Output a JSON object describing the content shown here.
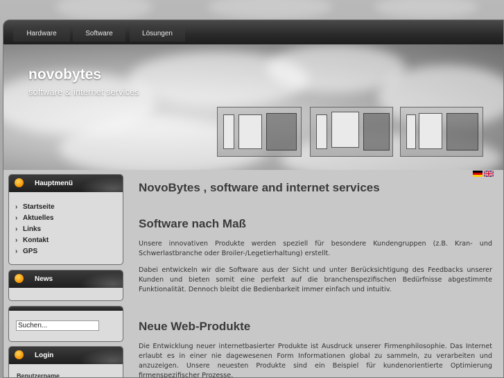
{
  "nav": {
    "tabs": [
      {
        "label": "Hardware"
      },
      {
        "label": "Software"
      },
      {
        "label": "Lösungen"
      }
    ]
  },
  "banner": {
    "title": "novobytes",
    "subtitle": "software & internet services"
  },
  "languages": {
    "flags": [
      "german-flag-icon",
      "english-flag-icon"
    ]
  },
  "sidebar": {
    "main_menu": {
      "title": "Hauptmenü",
      "items": [
        {
          "label": "Startseite"
        },
        {
          "label": "Aktuelles"
        },
        {
          "label": "Links"
        },
        {
          "label": "Kontakt"
        },
        {
          "label": "GPS"
        }
      ]
    },
    "news": {
      "title": "News"
    },
    "search": {
      "value": "Suchen..."
    },
    "login": {
      "title": "Login",
      "username_label": "Benutzername"
    }
  },
  "content": {
    "page_title": "NovoBytes , software and internet services",
    "sections": [
      {
        "heading": "Software nach Maß",
        "paragraphs": [
          "Unsere innovativen Produkte werden speziell für besondere Kundengruppen (z.B. Kran- und Schwerlastbranche oder Broiler-/Legetierhaltung) erstellt.",
          "Dabei entwickeln wir die Software aus der Sicht und unter Berücksichtigung des Feedbacks unserer Kunden und bieten somit eine perfekt auf die branchenspezifischen Bedürfnisse abgestimmte Funktionalität. Dennoch bleibt die Bedienbarkeit immer einfach und intuitiv."
        ]
      },
      {
        "heading": "Neue Web-Produkte",
        "paragraphs": [
          "Die Entwicklung neuer internetbasierter Produkte ist Ausdruck unserer Firmenphilosophie. Das Internet erlaubt es in einer nie dagewesenen Form Informationen global zu sammeln, zu verarbeiten und anzuzeigen. Unsere neuesten Produkte sind ein Beispiel für kundenorientierte Optimierung firmenspezifischer Prozesse."
        ]
      }
    ]
  },
  "colors": {
    "accent_orange": "#f39200",
    "nav_dark": "#2a2a2a"
  }
}
